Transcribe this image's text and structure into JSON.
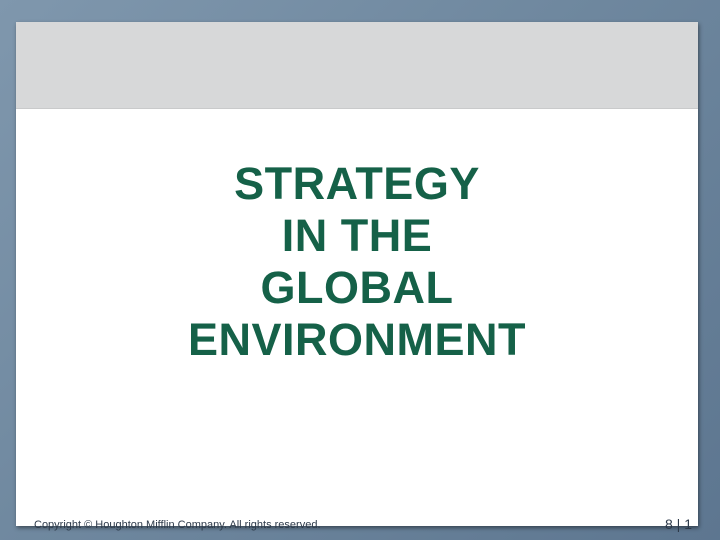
{
  "slide": {
    "title_lines": [
      "STRATEGY",
      "IN THE",
      "GLOBAL",
      "ENVIRONMENT"
    ]
  },
  "footer": {
    "copyright": "Copyright © Houghton Mifflin Company. All rights reserved.",
    "page_number": "8 | 1"
  },
  "colors": {
    "title": "#156148",
    "background": "#6f889f",
    "header_band": "#d7d8d9",
    "slide": "#ffffff"
  }
}
